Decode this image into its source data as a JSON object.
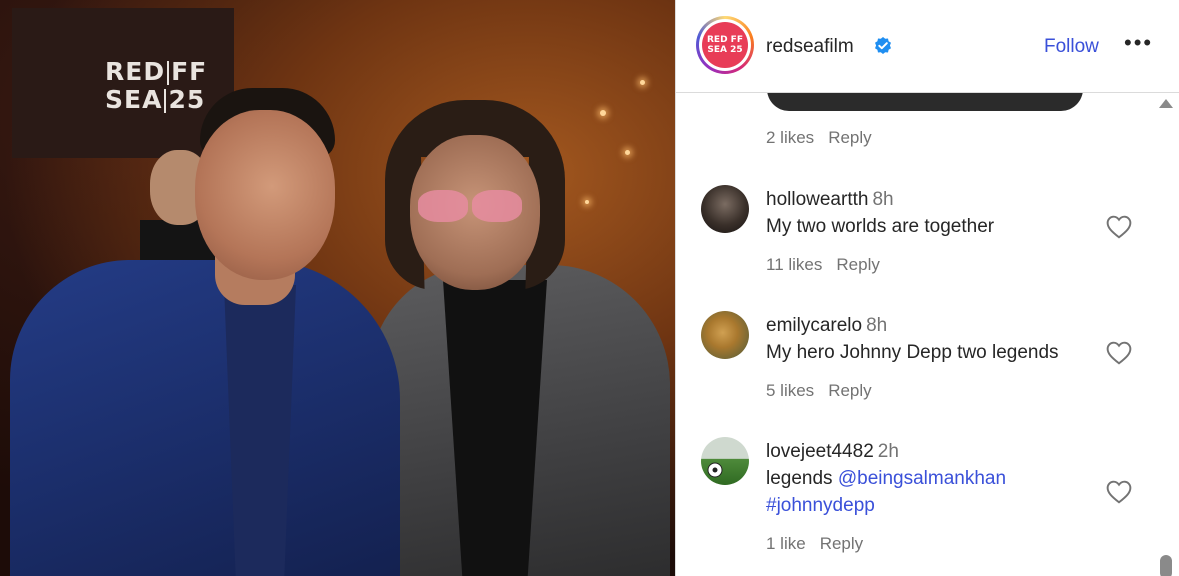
{
  "photo": {
    "banner_line1_a": "RED",
    "banner_line1_b": "FF",
    "banner_line2_a": "SEA",
    "banner_line2_b": "25"
  },
  "header": {
    "avatar_text": "RED FF SEA 25",
    "username": "redseafilm",
    "follow_label": "Follow",
    "more_label": "•••"
  },
  "comments": [
    {
      "likes": "2 likes",
      "reply": "Reply"
    },
    {
      "user": "holloweartth",
      "time": "8h",
      "text": "My two worlds are together",
      "likes": "11 likes",
      "reply": "Reply"
    },
    {
      "user": "emilycarelo",
      "time": "8h",
      "text": "My hero Johnny Depp two legends",
      "likes": "5 likes",
      "reply": "Reply"
    },
    {
      "user": "lovejeet4482",
      "time": "2h",
      "text_prefix": "legends",
      "mention": "@beingsalmankhan",
      "hashtag": "#johnnydepp",
      "likes": "1 like",
      "reply": "Reply"
    }
  ],
  "colors": {
    "follow": "#3a50d9",
    "verified": "#1f8ef1",
    "avatar_bg": "#e83c57"
  }
}
